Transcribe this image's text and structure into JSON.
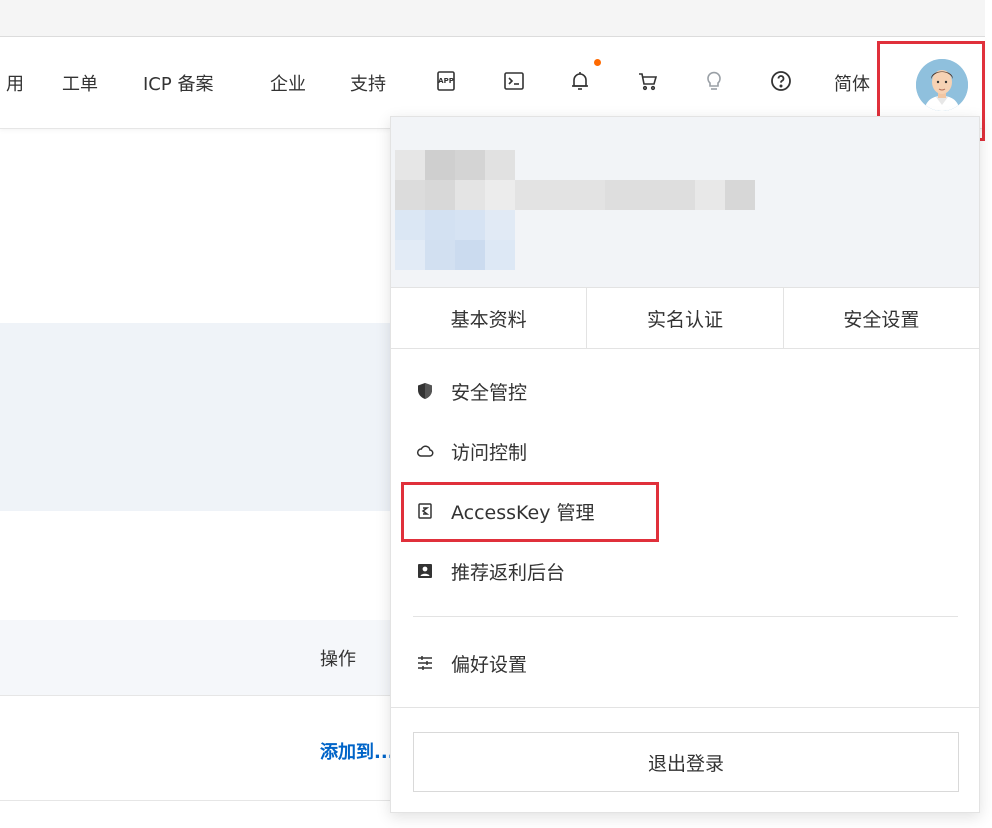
{
  "nav": {
    "items": [
      "用",
      "工单",
      "ICP 备案",
      "企业",
      "支持"
    ],
    "lang": "简体"
  },
  "icons": {
    "app": "app-icon",
    "terminal": "terminal-icon",
    "bell": "bell-icon",
    "cart": "cart-icon",
    "bulb": "lightbulb-icon",
    "help": "help-circle-icon"
  },
  "colors": {
    "accent": "#ff6a00",
    "highlight_box": "#e0303b",
    "link": "#0064c8"
  },
  "background": {
    "ops_header": "操作",
    "row_link": "添加到..."
  },
  "dropdown": {
    "tabs": [
      "基本资料",
      "实名认证",
      "安全设置"
    ],
    "menu": [
      {
        "label": "安全管控",
        "icon": "shield-icon"
      },
      {
        "label": "访问控制",
        "icon": "cloud-icon"
      },
      {
        "label": "AccessKey 管理",
        "icon": "key-icon"
      },
      {
        "label": "推荐返利后台",
        "icon": "portrait-icon"
      },
      {
        "label": "偏好设置",
        "icon": "sliders-icon"
      }
    ],
    "logout": "退出登录"
  }
}
